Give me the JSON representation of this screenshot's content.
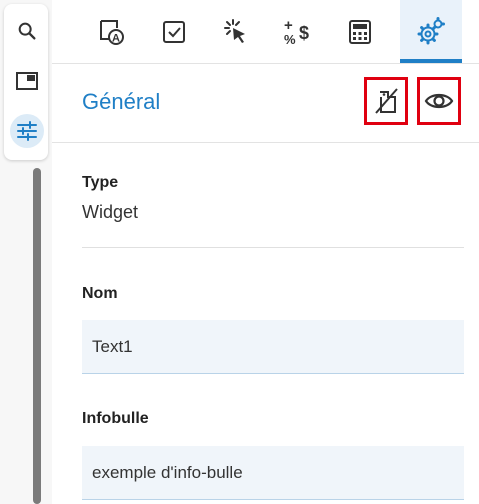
{
  "rail": {
    "items": [
      {
        "icon": "search-icon"
      },
      {
        "icon": "window-icon"
      },
      {
        "icon": "sliders-icon",
        "active": true
      }
    ]
  },
  "tabs": [
    {
      "icon": "auto-format-icon"
    },
    {
      "icon": "checkbox-icon"
    },
    {
      "icon": "click-cursor-icon"
    },
    {
      "icon": "plus-percent-dollar-icon"
    },
    {
      "icon": "calculator-icon"
    },
    {
      "icon": "gears-icon",
      "active": true
    }
  ],
  "section": {
    "title": "Général",
    "actions": [
      {
        "icon": "crossed-out-tag-icon"
      },
      {
        "icon": "eye-icon"
      }
    ]
  },
  "properties": {
    "type_label": "Type",
    "type_value": "Widget",
    "name_label": "Nom",
    "name_value": "Text1",
    "tooltip_label": "Infobulle",
    "tooltip_value": "exemple d'info-bulle"
  },
  "colors": {
    "accent": "#1f7fc6",
    "highlight_border": "#e00010",
    "field_background": "#f0f5fa"
  }
}
